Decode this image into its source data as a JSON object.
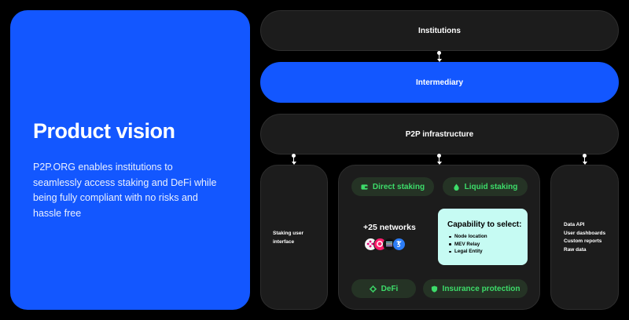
{
  "hero": {
    "title": "Product vision",
    "description": "P2P.ORG enables institutions to seamlessly access staking and DeFi while being fully compliant with no risks and hassle free"
  },
  "layers": {
    "institutions": "Institutions",
    "intermediary": "Intermediary",
    "infrastructure": "P2P infrastructure"
  },
  "left_card": {
    "line1": "Staking user",
    "line2": "interface"
  },
  "center_card": {
    "direct_staking": "Direct staking",
    "liquid_staking": "Liquid staking",
    "networks": "+25 networks",
    "defi": "DeFi",
    "insurance": "Insurance protection",
    "capability": {
      "title": "Capability to select:",
      "items": [
        "Node location",
        "MEV Relay",
        "Legal Entity"
      ]
    }
  },
  "right_card": {
    "items": [
      "Data API",
      "User dashboards",
      "Custom reports",
      "Raw data"
    ]
  },
  "colors": {
    "brand_blue": "#1357ff",
    "accent_green": "#3ddc6a",
    "capability_bg": "#c6fbf3",
    "panel_bg": "#1c1c1c"
  },
  "icons": {
    "direct_staking": "wallet-icon",
    "liquid_staking": "droplet-icon",
    "defi": "gear-icon",
    "insurance": "shield-icon",
    "network_logos": [
      "polkadot-logo",
      "celo-logo",
      "solana-logo",
      "tezos-logo"
    ]
  }
}
